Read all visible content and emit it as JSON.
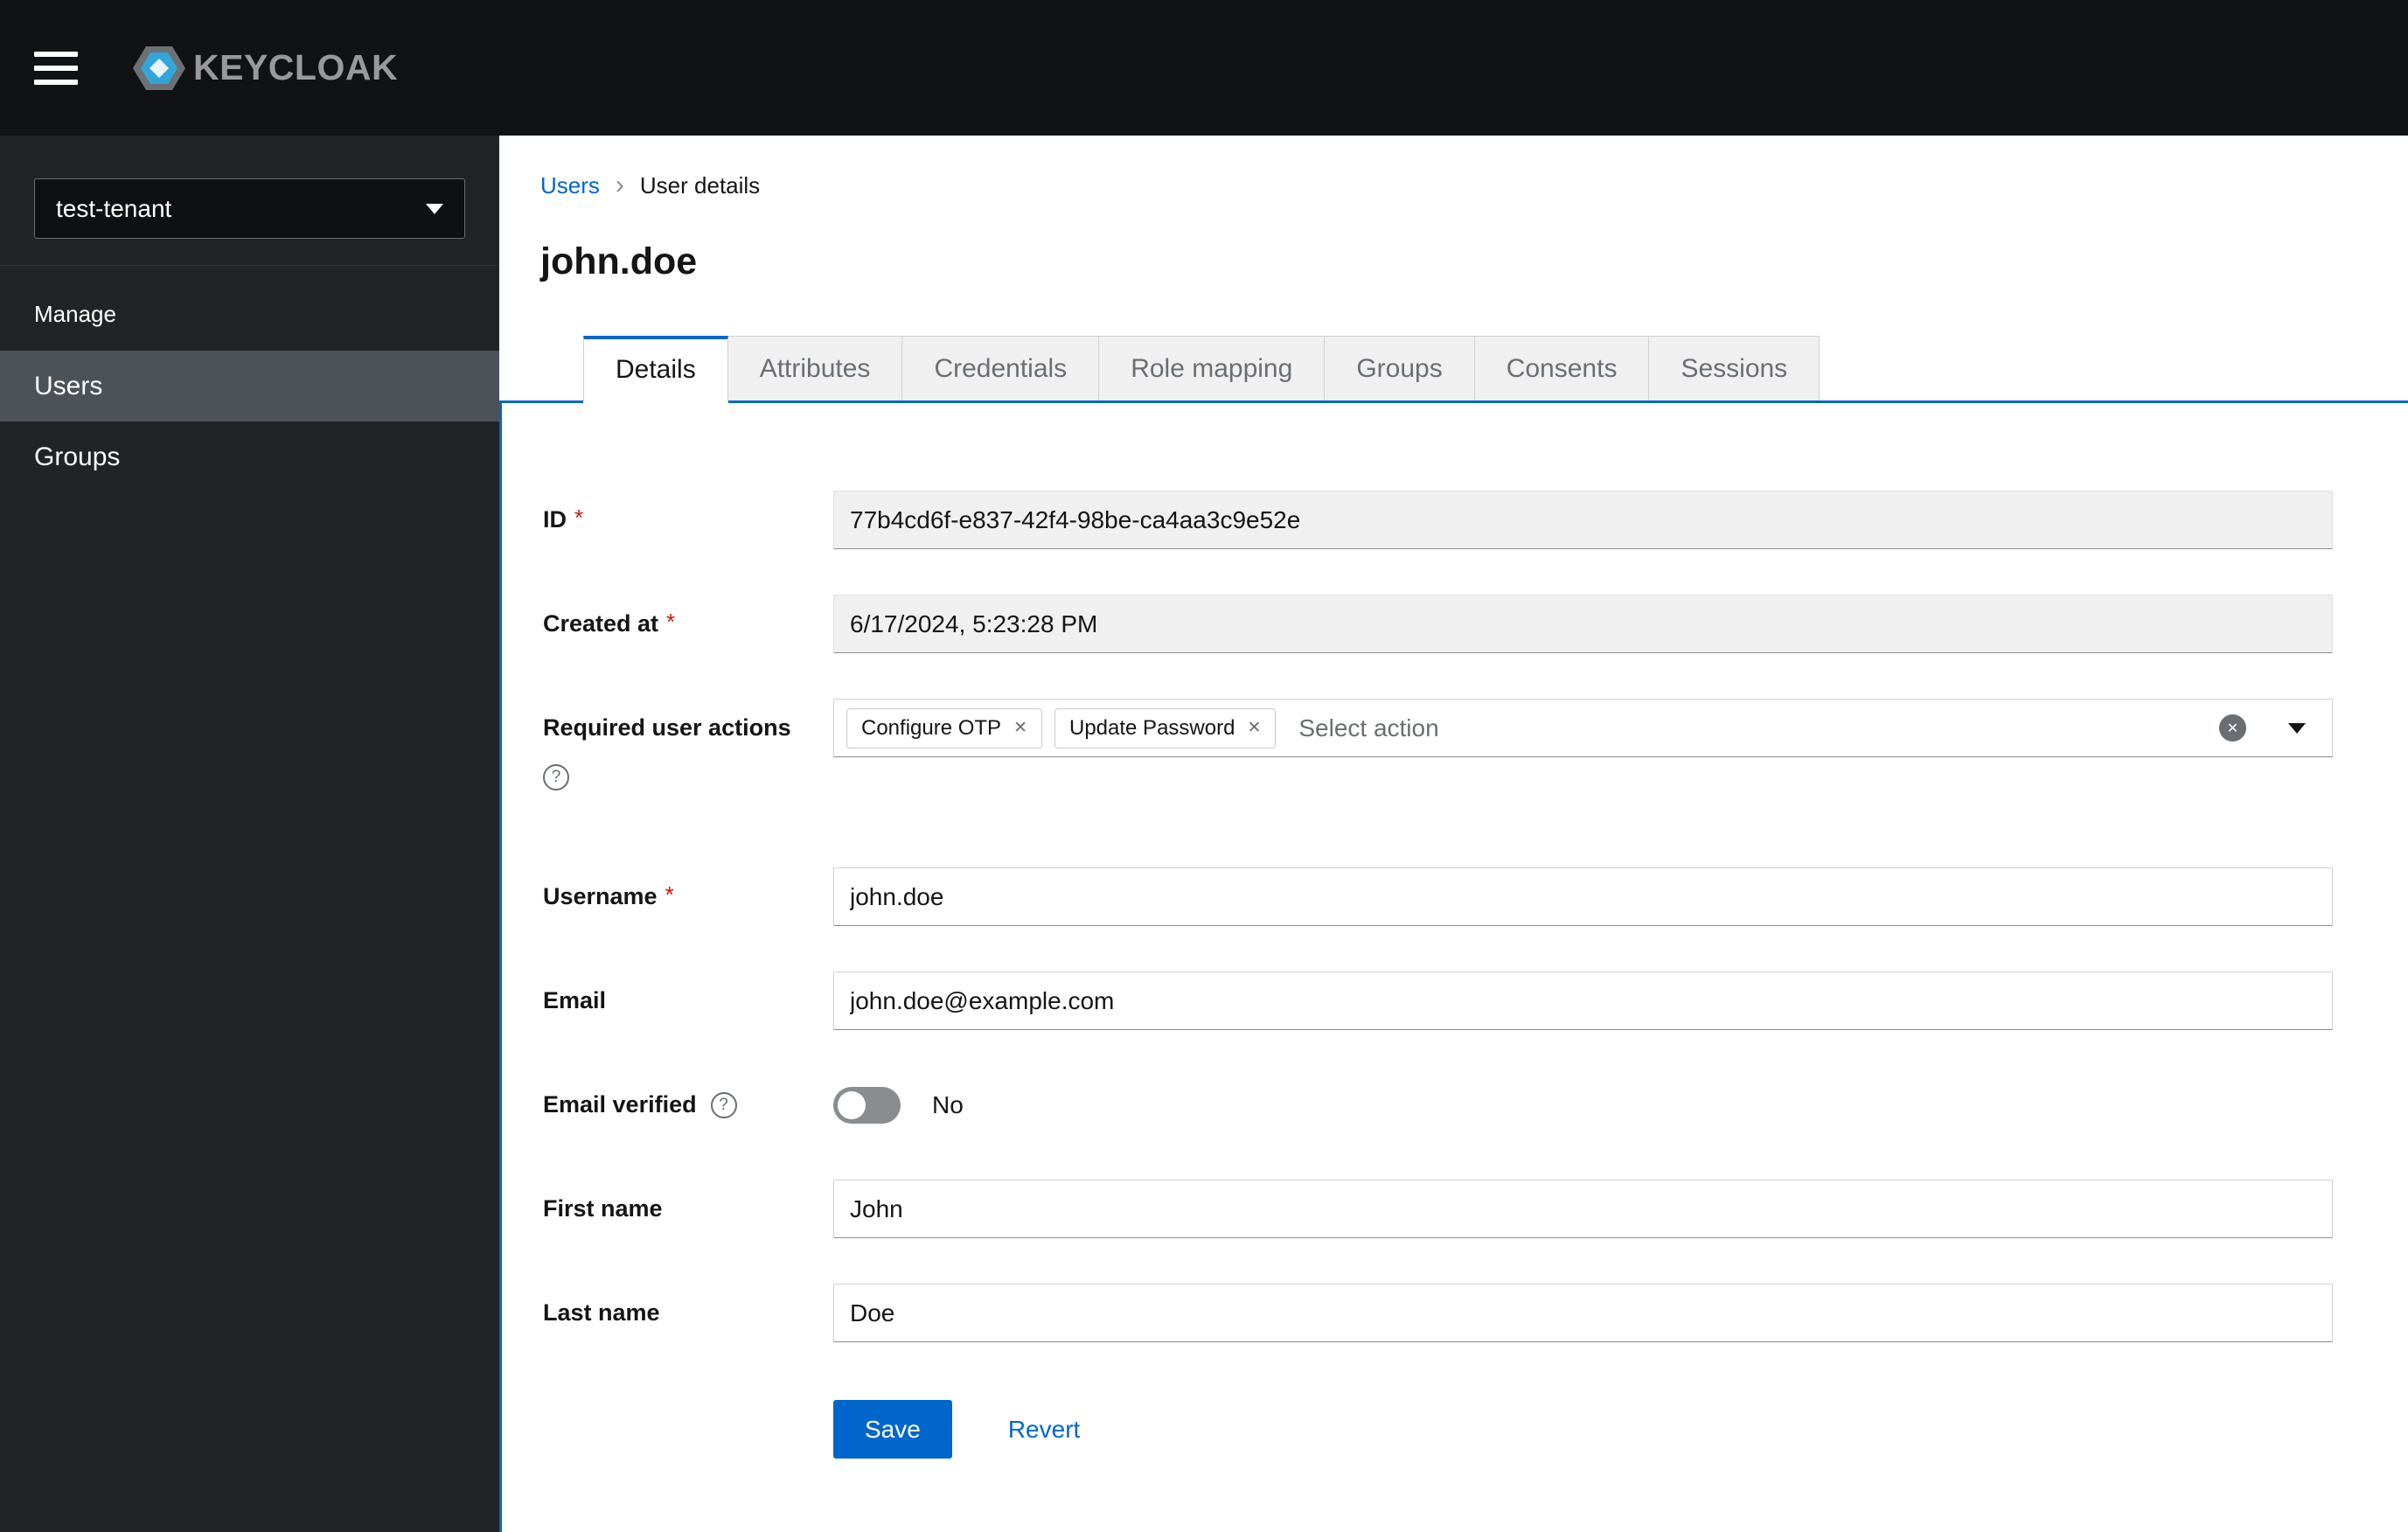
{
  "masthead": {
    "logo_text": "KEYCLOAK"
  },
  "sidebar": {
    "realm": "test-tenant",
    "section": "Manage",
    "items": [
      {
        "label": "Users",
        "active": true
      },
      {
        "label": "Groups",
        "active": false
      }
    ]
  },
  "breadcrumb": {
    "link": "Users",
    "current": "User details"
  },
  "page": {
    "title": "john.doe"
  },
  "tabs": {
    "active": "Details",
    "items": [
      "Details",
      "Attributes",
      "Credentials",
      "Role mapping",
      "Groups",
      "Consents",
      "Sessions"
    ]
  },
  "form": {
    "required_mark": "*",
    "id": {
      "label": "ID",
      "required": true,
      "readonly": true,
      "value": "77b4cd6f-e837-42f4-98be-ca4aa3c9e52e"
    },
    "created_at": {
      "label": "Created at",
      "required": true,
      "readonly": true,
      "value": "6/17/2024, 5:23:28 PM"
    },
    "required_actions": {
      "label": "Required user actions",
      "chips": [
        {
          "label": "Configure OTP"
        },
        {
          "label": "Update Password"
        }
      ],
      "placeholder": "Select action"
    },
    "username": {
      "label": "Username",
      "required": true,
      "value": "john.doe"
    },
    "email": {
      "label": "Email",
      "value": "john.doe@example.com"
    },
    "email_verified": {
      "label": "Email verified",
      "checked": false,
      "state_label": "No"
    },
    "first_name": {
      "label": "First name",
      "value": "John"
    },
    "last_name": {
      "label": "Last name",
      "value": "Doe"
    }
  },
  "actions": {
    "save": "Save",
    "revert": "Revert"
  },
  "colors": {
    "accent": "#0066cc",
    "required": "#c9190b",
    "masthead_bg": "#111214",
    "sidebar_bg": "#212427",
    "sidebar_active_bg": "#4d5258"
  }
}
